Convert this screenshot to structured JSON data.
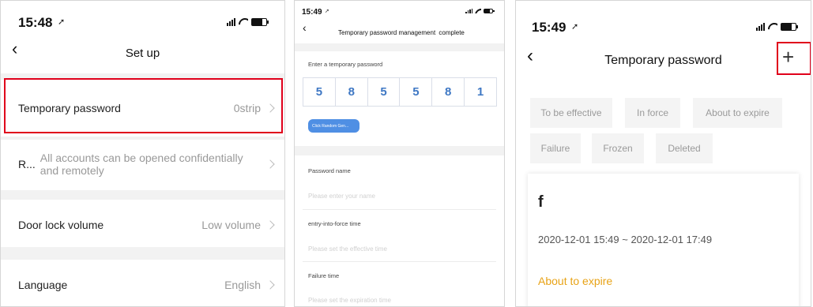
{
  "panel1": {
    "status": {
      "time": "15:48"
    },
    "nav": {
      "title": "Set up"
    },
    "rows": [
      {
        "label": "Temporary password",
        "value": "0strip"
      },
      {
        "label": "R...",
        "value": "All accounts can be opened confidentially and remotely"
      },
      {
        "label": "Door lock volume",
        "value": "Low volume"
      },
      {
        "label": "Language",
        "value": "English"
      }
    ]
  },
  "panel2": {
    "status": {
      "time": "15:49"
    },
    "nav": {
      "title": "Temporary password management",
      "action": "complete"
    },
    "enter_label": "Enter a temporary password",
    "digits": [
      "5",
      "8",
      "5",
      "5",
      "8",
      "1"
    ],
    "random_button": "Click Random Gen...",
    "password_name_label": "Password name",
    "password_name_placeholder": "Please enter your name",
    "entry_time_label": "entry-into-force time",
    "entry_time_placeholder": "Please set the effective time",
    "failure_time_label": "Failure time",
    "failure_time_placeholder": "Please set the expiration time"
  },
  "panel3": {
    "status": {
      "time": "15:49"
    },
    "nav": {
      "title": "Temporary password",
      "add": "+"
    },
    "tags": [
      "To be effective",
      "In force",
      "About to expire",
      "Failure",
      "Frozen",
      "Deleted"
    ],
    "card": {
      "name": "f",
      "period": "2020-12-01 15:49 ~ 2020-12-01 17:49",
      "status": "About to expire"
    }
  },
  "colors": {
    "highlight": "#e0001b",
    "digit_blue": "#3f78c4",
    "button_blue": "#4f8fe4",
    "status_orange": "#e8a317"
  }
}
